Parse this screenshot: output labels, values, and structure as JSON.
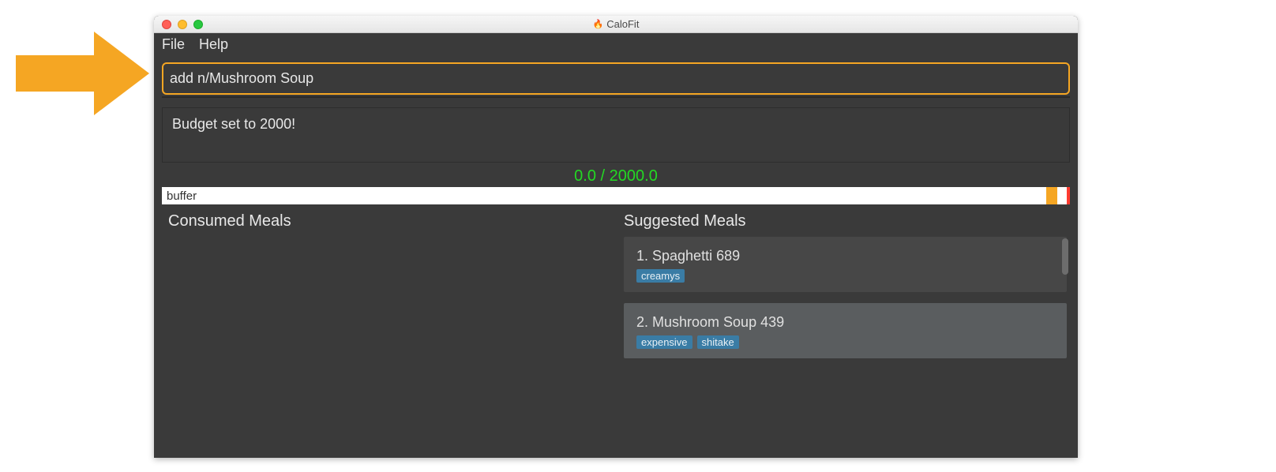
{
  "app_title": "CaloFit",
  "menu": {
    "file": "File",
    "help": "Help"
  },
  "command_input": {
    "value": "add n/Mushroom Soup"
  },
  "feedback": "Budget set to 2000!",
  "budget_counter": "0.0 / 2000.0",
  "progress_label": "buffer",
  "panels": {
    "consumed_title": "Consumed Meals",
    "suggested_title": "Suggested Meals"
  },
  "suggested_meals": [
    {
      "index": "1.",
      "name": "Spaghetti",
      "calories": "689",
      "tags": [
        "creamys"
      ],
      "highlight": false
    },
    {
      "index": "2.",
      "name": "Mushroom Soup",
      "calories": "439",
      "tags": [
        "expensive",
        "shitake"
      ],
      "highlight": true
    }
  ],
  "colors": {
    "accent_orange": "#f5a623",
    "counter_green": "#23d923",
    "tag_bg": "#3a7ca5"
  }
}
